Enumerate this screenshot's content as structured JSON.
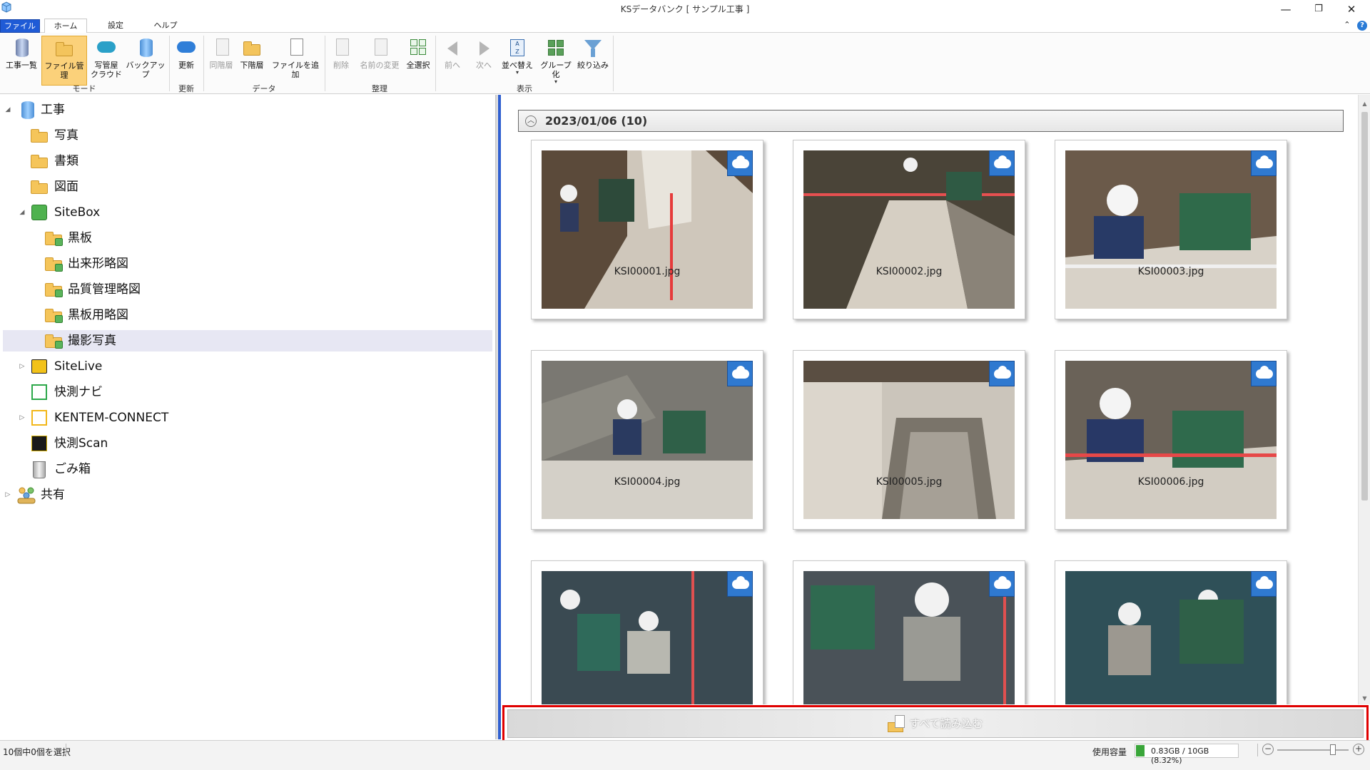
{
  "window": {
    "title": "KSデータバンク [ サンプル工事 ]",
    "minimize": "—",
    "restore": "❐",
    "close": "✕"
  },
  "tabs": [
    {
      "label": "ファイル"
    },
    {
      "label": "ホーム"
    },
    {
      "label": "設定"
    },
    {
      "label": "ヘルプ"
    }
  ],
  "help": {
    "collapse": "⌃",
    "question": "?"
  },
  "ribbon": {
    "buttons": {
      "project_list": "工事一覧",
      "file_mgmt": "ファイル管理",
      "photo_cloud_1": "写管屋",
      "photo_cloud_2": "クラウド",
      "backup": "バックアップ",
      "refresh": "更新",
      "same_level": "同階層",
      "lower_level": "下階層",
      "add_file": "ファイルを追加",
      "delete": "削除",
      "rename": "名前の変更",
      "select_all": "全選択",
      "prev": "前へ",
      "next": "次へ",
      "sort": "並べ替え",
      "group": "グループ化",
      "filter": "絞り込み"
    },
    "groups": {
      "mode": "モード",
      "refresh": "更新",
      "data": "データ",
      "organize": "整理",
      "view": "表示"
    }
  },
  "tree": [
    {
      "label": "工事"
    },
    {
      "label": "写真"
    },
    {
      "label": "書類"
    },
    {
      "label": "図面"
    },
    {
      "label": "SiteBox"
    },
    {
      "label": "黒板"
    },
    {
      "label": "出来形略図"
    },
    {
      "label": "品質管理略図"
    },
    {
      "label": "黒板用略図"
    },
    {
      "label": "撮影写真"
    },
    {
      "label": "SiteLive"
    },
    {
      "label": "快測ナビ"
    },
    {
      "label": "KENTEM-CONNECT"
    },
    {
      "label": "快測Scan"
    },
    {
      "label": "ごみ箱"
    },
    {
      "label": "共有"
    }
  ],
  "gallery": {
    "group_header": "2023/01/06 (10)",
    "photos": [
      {
        "name": "KSI00001.jpg"
      },
      {
        "name": "KSI00002.jpg"
      },
      {
        "name": "KSI00003.jpg"
      },
      {
        "name": "KSI00004.jpg"
      },
      {
        "name": "KSI00005.jpg"
      },
      {
        "name": "KSI00006.jpg"
      },
      {
        "name": ""
      },
      {
        "name": ""
      },
      {
        "name": ""
      }
    ]
  },
  "load_all": {
    "label": "すべて読み込む"
  },
  "status": {
    "selection": "10個中0個を選択",
    "usage_label": "使用容量",
    "usage_text": "0.83GB / 10GB (8.32%)",
    "usage_fraction": 0.0832,
    "zoom_minus": "−",
    "zoom_plus": "+"
  },
  "colors": {
    "accent_blue": "#1f5bd6",
    "highlight_red": "#e00000",
    "usage_green": "#3aa63a",
    "selected_ribbon": "#fbd17a"
  }
}
